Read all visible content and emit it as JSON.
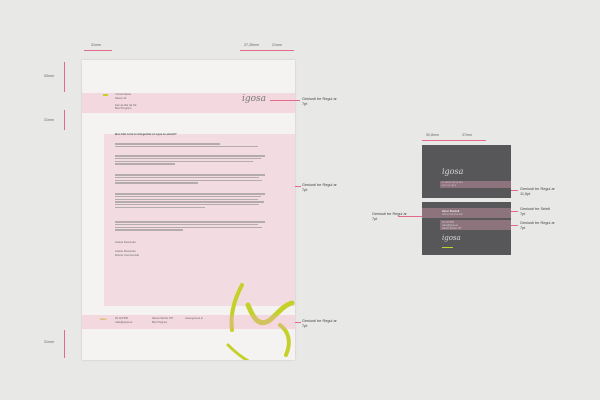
{
  "dimensions": {
    "top_margin_left": "31mm",
    "top_right_a": "37,35mm",
    "top_right_b": "21mm",
    "left_v_1": "53mm",
    "left_v_2": "31mm",
    "left_v_3": "31mm",
    "card_w_a": "50,8mm",
    "card_w_b": "37mm"
  },
  "letterhead": {
    "header_block": [
      "Yunus Name",
      "Street 12",
      "",
      "Fax as We 3a Str",
      "Bos Program"
    ],
    "logo_text": "igosa",
    "subject": "Bus Idio lorte le Integerble ut sque te elemit?",
    "salutation_1": "Ariane Dvannoki",
    "salutation_2": "Dolore Commercial",
    "closing": "Ariane Dvannoki",
    "footer": {
      "label": "Nabo",
      "col1": [
        "39 123 555",
        "nabo@igosa.ie"
      ],
      "col2": [
        "Narosi Stozko 797",
        "Bos Program"
      ],
      "col3": [
        "www.igosa.ie.ie"
      ]
    }
  },
  "annotations": {
    "note1_a": "Geniusti tre Regul ar",
    "note1_b": "7pt",
    "note2_a": "Geniusti tre Regul ar",
    "note2_b": "7pt",
    "note3_a": "Geniusti tre Regul ar",
    "note3_b": "7pt",
    "card_left_a": "Geniusti tre Regul ar",
    "card_left_b": "7pt",
    "card_note1_a": "Geniusti tre Regul ar",
    "card_note1_b": "11,5pt",
    "card_note2_a": "Geniusti tre Seleti",
    "card_note2_b": "7pt",
    "card_note3_a": "Geniusti tre Regul ar",
    "card_note3_b": "7pt"
  },
  "card_front": {
    "logo_text": "igosa",
    "tagline_1": "in clever Alt pi aes",
    "tagline_2": "sa in ar gion"
  },
  "card_back": {
    "name": "Ishar Ducteli",
    "role": "Gbl to Commerciel",
    "logo_text": "igosa",
    "lines": [
      "39 123 555",
      "nabo@igosa.ie",
      "Narosi Stozko 797"
    ]
  },
  "colors": {
    "accent_pink": "#e46a8c",
    "accent_lime": "#c4d12a",
    "card_gray": "#57575a"
  }
}
